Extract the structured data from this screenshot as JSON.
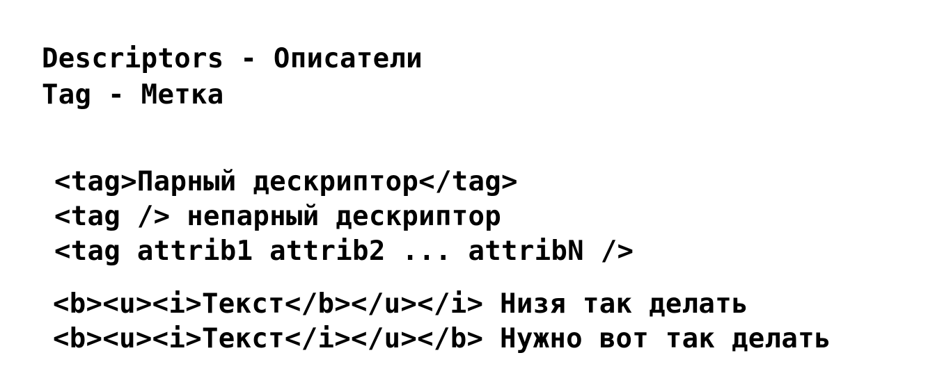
{
  "heading": {
    "line1": "Descriptors - Описатели",
    "line2": "Tag - Метка"
  },
  "examples": [
    "<tag>Парный дескриптор</tag>",
    "<tag /> непарный дескриптор",
    "<tag attrib1 attrib2 ... attribN />"
  ],
  "nesting": [
    "<b><u><i>Текст</b></u></i> Низя так делать",
    "<b><u><i>Текст</i></u></b> Нужно вот так делать"
  ]
}
